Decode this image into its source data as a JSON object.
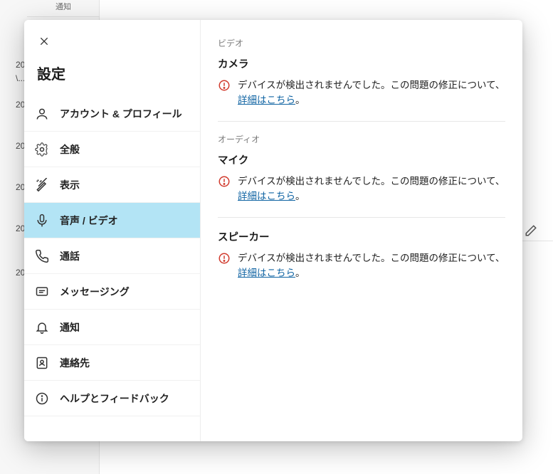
{
  "background": {
    "tab": "通知",
    "partial": "\\...",
    "rows": [
      "20",
      "20",
      "20",
      "20",
      "20",
      "20"
    ]
  },
  "modal": {
    "title": "設定",
    "nav": [
      {
        "label": "アカウント & プロフィール",
        "icon": "person"
      },
      {
        "label": "全般",
        "icon": "gear"
      },
      {
        "label": "表示",
        "icon": "wand"
      },
      {
        "label": "音声 / ビデオ",
        "icon": "mic"
      },
      {
        "label": "通話",
        "icon": "phone"
      },
      {
        "label": "メッセージング",
        "icon": "message"
      },
      {
        "label": "通知",
        "icon": "bell"
      },
      {
        "label": "連絡先",
        "icon": "contacts"
      },
      {
        "label": "ヘルプとフィードバック",
        "icon": "info"
      }
    ]
  },
  "content": {
    "videoLabel": "ビデオ",
    "cameraLabel": "カメラ",
    "audioLabel": "オーディオ",
    "micLabel": "マイク",
    "speakerLabel": "スピーカー",
    "noDeviceMsg": "デバイスが検出されませんでした。この問題の修正について、",
    "learnMore": "詳細はこちら",
    "period": "。"
  }
}
